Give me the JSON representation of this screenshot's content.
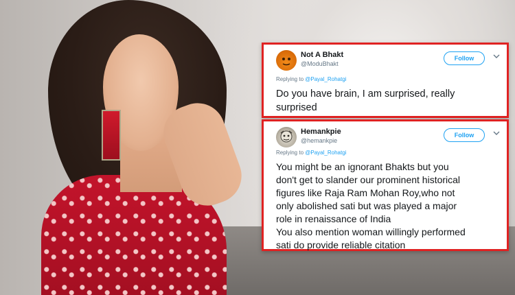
{
  "tweets": [
    {
      "name": "Not A Bhakt",
      "handle": "@ModuBhakt",
      "follow_label": "Follow",
      "replying_prefix": "Replying to",
      "replying_to": "@Payal_Rohatgi",
      "text_lines": [
        "Do you have brain, I am surprised, really",
        "surprised"
      ],
      "avatar_icon": "orange-face-avatar-icon"
    },
    {
      "name": "Hemankpie",
      "handle": "@hemankpie",
      "follow_label": "Follow",
      "replying_prefix": "Replying to",
      "replying_to": "@Payal_Rohatgi",
      "text_lines": [
        "You might be an ignorant Bhakts but you",
        "don't get to slander our prominent historical",
        "figures like Raja Ram Mohan Roy,who not",
        "only abolished sati but was played a major",
        "role in renaissance of India",
        " You also mention woman willingly performed",
        "sati do provide reliable citation"
      ],
      "avatar_icon": "cartoon-avatar-icon"
    }
  ],
  "colors": {
    "card_border": "#e02222",
    "link_blue": "#1da1f2",
    "text_dark": "#14171a",
    "text_muted": "#657786"
  }
}
